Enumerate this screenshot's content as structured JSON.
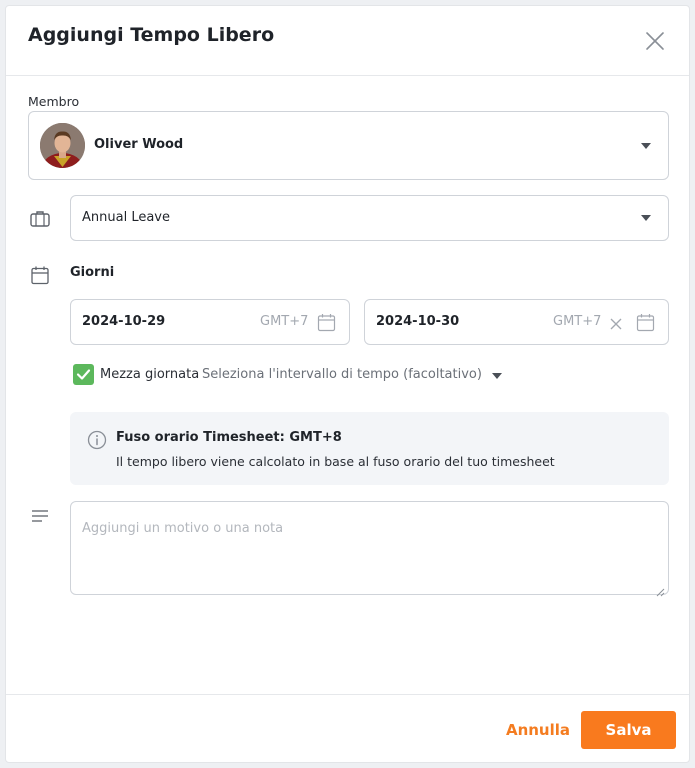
{
  "dialog": {
    "title": "Aggiungi Tempo Libero",
    "close_icon": "close-icon"
  },
  "member": {
    "label": "Membro",
    "selected_name": "Oliver Wood",
    "avatar_icon": "avatar"
  },
  "leave_type": {
    "icon": "briefcase-icon",
    "selected": "Annual Leave"
  },
  "days": {
    "icon": "calendar-icon",
    "label": "Giorni",
    "start_date": "2024-10-29",
    "start_timezone": "GMT+7",
    "end_date": "2024-10-30",
    "end_timezone": "GMT+7"
  },
  "half_day": {
    "checked": true,
    "label": "Mezza giornata",
    "time_range_placeholder": "Seleziona l'intervallo di tempo (facoltativo)"
  },
  "info": {
    "icon": "info-icon",
    "title": "Fuso orario Timesheet: GMT+8",
    "text": "Il tempo libero viene calcolato in base al fuso orario del tuo timesheet"
  },
  "note": {
    "icon": "text-lines-icon",
    "placeholder": "Aggiungi un motivo o una nota"
  },
  "footer": {
    "cancel_label": "Annulla",
    "save_label": "Salva"
  },
  "colors": {
    "accent": "#f97a1e",
    "checkbox": "#5cb85c",
    "info_bg": "#f3f5f8"
  }
}
